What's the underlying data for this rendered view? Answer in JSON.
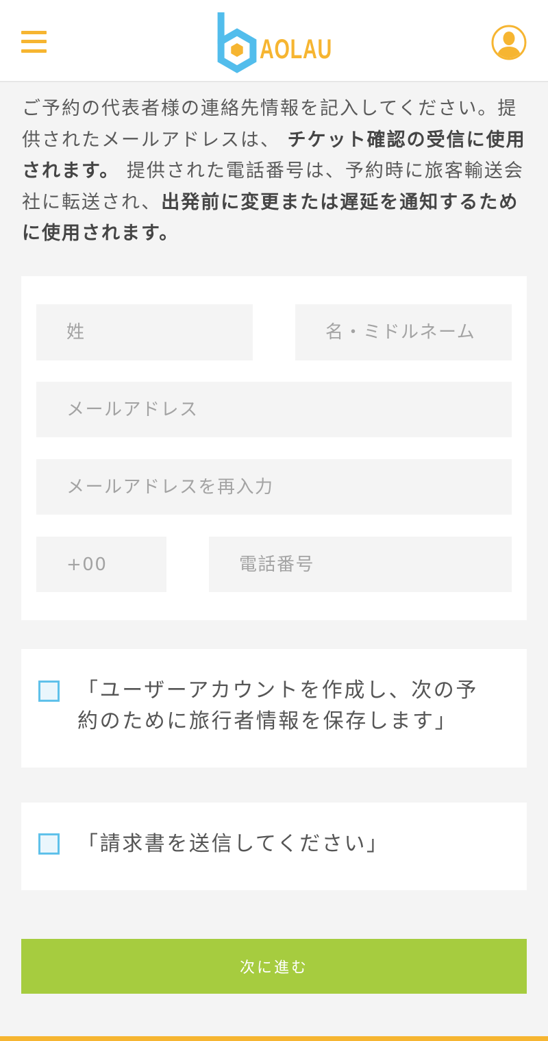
{
  "header": {
    "menu_icon": "hamburger-menu-icon",
    "logo_icon": "b-hexagon-logo-icon",
    "logo_text": "AOLAU",
    "avatar_icon": "user-avatar-icon"
  },
  "intro": {
    "segments": [
      {
        "text": "ご予約の代表者様の連絡先情報を記入してください。提供されたメールアドレスは、 ",
        "bold": false
      },
      {
        "text": "チケット確認の受信に使用されます。",
        "bold": true
      },
      {
        "text": " 提供された電話番号は、予約時に旅客輸送会社に転送され、",
        "bold": false
      },
      {
        "text": "出発前に変更または遅延を通知するために使用されます。",
        "bold": true
      }
    ]
  },
  "form": {
    "last_name_placeholder": "姓",
    "first_name_placeholder": "名・ミドルネーム",
    "email_placeholder": "メールアドレス",
    "email_confirm_placeholder": "メールアドレスを再入力",
    "phone_code_placeholder": "+00",
    "phone_placeholder": "電話番号"
  },
  "options": [
    {
      "label": "「ユーザーアカウントを作成し、次の予約のために旅行者情報を保存します」",
      "checked": false
    },
    {
      "label": "「請求書を送信してください」",
      "checked": false
    }
  ],
  "next_button": {
    "label": "次に進む"
  },
  "colors": {
    "accent_yellow": "#f6b531",
    "logo_blue": "#52bdec",
    "button_green": "#a6cc3f",
    "checkbox_blue": "#5fc1ea",
    "background": "#f4f4f4"
  }
}
